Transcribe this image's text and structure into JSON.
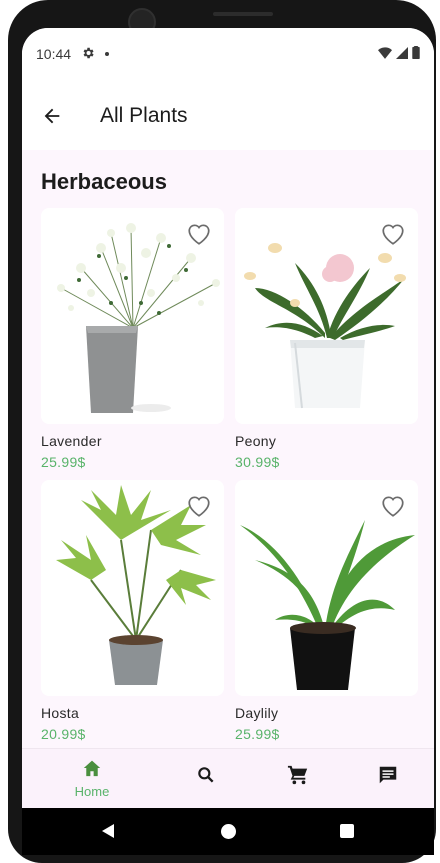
{
  "status_bar": {
    "time": "10:44"
  },
  "app_bar": {
    "title": "All Plants"
  },
  "section": {
    "title": "Herbaceous"
  },
  "plants": [
    {
      "name": "Lavender",
      "price": "25.99$"
    },
    {
      "name": "Peony",
      "price": "30.99$"
    },
    {
      "name": "Hosta",
      "price": "20.99$"
    },
    {
      "name": "Daylily",
      "price": "25.99$"
    }
  ],
  "bottom_nav": {
    "home_label": "Home"
  },
  "colors": {
    "accent": "#59b36a",
    "background": "#fdf6fd"
  }
}
